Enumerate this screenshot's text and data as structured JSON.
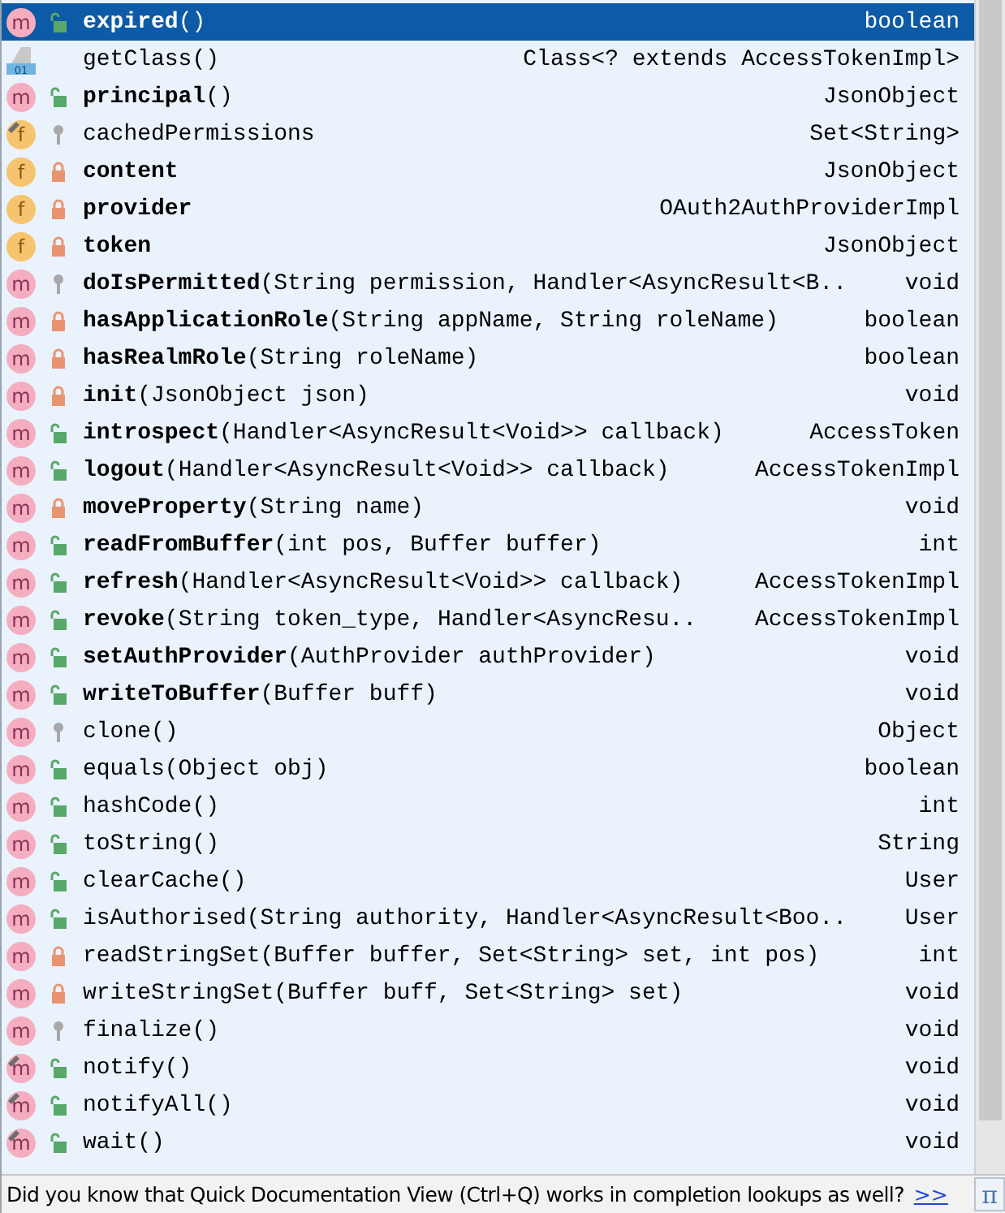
{
  "items": [
    {
      "kind": "method",
      "badge": "m",
      "access": {
        "kind": "public"
      },
      "inherited": false,
      "selected": true,
      "label": "**expired**()",
      "type": "boolean"
    },
    {
      "kind": "class",
      "badge": "01",
      "access": {
        "kind": "none"
      },
      "inherited": false,
      "selected": false,
      "label": "getClass()",
      "type": "Class<? extends AccessTokenImpl>"
    },
    {
      "kind": "method",
      "badge": "m",
      "access": {
        "kind": "public"
      },
      "inherited": false,
      "selected": false,
      "label": "**principal**()",
      "type": "JsonObject"
    },
    {
      "kind": "field",
      "badge": "f",
      "access": {
        "kind": "protected"
      },
      "inherited": true,
      "selected": false,
      "label": "cachedPermissions",
      "type": "Set<String>"
    },
    {
      "kind": "field",
      "badge": "f",
      "access": {
        "kind": "private"
      },
      "inherited": false,
      "selected": false,
      "label": "**content**",
      "type": "JsonObject"
    },
    {
      "kind": "field",
      "badge": "f",
      "access": {
        "kind": "private"
      },
      "inherited": false,
      "selected": false,
      "label": "**provider**",
      "type": "OAuth2AuthProviderImpl"
    },
    {
      "kind": "field",
      "badge": "f",
      "access": {
        "kind": "private"
      },
      "inherited": false,
      "selected": false,
      "label": "**token**",
      "type": "JsonObject"
    },
    {
      "kind": "method",
      "badge": "m",
      "access": {
        "kind": "protected"
      },
      "inherited": false,
      "selected": false,
      "label": "**doIsPermitted**(String permission, Handler<AsyncResult<B..",
      "type": "void"
    },
    {
      "kind": "method",
      "badge": "m",
      "access": {
        "kind": "private"
      },
      "inherited": false,
      "selected": false,
      "label": "**hasApplicationRole**(String appName, String roleName)",
      "type": "boolean"
    },
    {
      "kind": "method",
      "badge": "m",
      "access": {
        "kind": "private"
      },
      "inherited": false,
      "selected": false,
      "label": "**hasRealmRole**(String roleName)",
      "type": "boolean"
    },
    {
      "kind": "method",
      "badge": "m",
      "access": {
        "kind": "private"
      },
      "inherited": false,
      "selected": false,
      "label": "**init**(JsonObject json)",
      "type": "void"
    },
    {
      "kind": "method",
      "badge": "m",
      "access": {
        "kind": "public"
      },
      "inherited": false,
      "selected": false,
      "label": "**introspect**(Handler<AsyncResult<Void>> callback)",
      "type": "AccessToken"
    },
    {
      "kind": "method",
      "badge": "m",
      "access": {
        "kind": "public"
      },
      "inherited": false,
      "selected": false,
      "label": "**logout**(Handler<AsyncResult<Void>> callback)",
      "type": "AccessTokenImpl"
    },
    {
      "kind": "method",
      "badge": "m",
      "access": {
        "kind": "private"
      },
      "inherited": false,
      "selected": false,
      "label": "**moveProperty**(String name)",
      "type": "void"
    },
    {
      "kind": "method",
      "badge": "m",
      "access": {
        "kind": "public"
      },
      "inherited": false,
      "selected": false,
      "label": "**readFromBuffer**(int pos, Buffer buffer)",
      "type": "int"
    },
    {
      "kind": "method",
      "badge": "m",
      "access": {
        "kind": "public"
      },
      "inherited": false,
      "selected": false,
      "label": "**refresh**(Handler<AsyncResult<Void>> callback)",
      "type": "AccessTokenImpl"
    },
    {
      "kind": "method",
      "badge": "m",
      "access": {
        "kind": "public"
      },
      "inherited": false,
      "selected": false,
      "label": "**revoke**(String token_type, Handler<AsyncResu..",
      "type": "AccessTokenImpl"
    },
    {
      "kind": "method",
      "badge": "m",
      "access": {
        "kind": "public"
      },
      "inherited": false,
      "selected": false,
      "label": "**setAuthProvider**(AuthProvider authProvider)",
      "type": "void"
    },
    {
      "kind": "method",
      "badge": "m",
      "access": {
        "kind": "public"
      },
      "inherited": false,
      "selected": false,
      "label": "**writeToBuffer**(Buffer buff)",
      "type": "void"
    },
    {
      "kind": "method",
      "badge": "m",
      "access": {
        "kind": "protected"
      },
      "inherited": false,
      "selected": false,
      "label": "clone()",
      "type": "Object"
    },
    {
      "kind": "method",
      "badge": "m",
      "access": {
        "kind": "public"
      },
      "inherited": false,
      "selected": false,
      "label": "equals(Object obj)",
      "type": "boolean"
    },
    {
      "kind": "method",
      "badge": "m",
      "access": {
        "kind": "public"
      },
      "inherited": false,
      "selected": false,
      "label": "hashCode()",
      "type": "int"
    },
    {
      "kind": "method",
      "badge": "m",
      "access": {
        "kind": "public"
      },
      "inherited": false,
      "selected": false,
      "label": "toString()",
      "type": "String"
    },
    {
      "kind": "method",
      "badge": "m",
      "access": {
        "kind": "public"
      },
      "inherited": false,
      "selected": false,
      "label": "clearCache()",
      "type": "User"
    },
    {
      "kind": "method",
      "badge": "m",
      "access": {
        "kind": "public"
      },
      "inherited": false,
      "selected": false,
      "label": "isAuthorised(String authority, Handler<AsyncResult<Boo..",
      "type": "User"
    },
    {
      "kind": "method",
      "badge": "m",
      "access": {
        "kind": "private"
      },
      "inherited": false,
      "selected": false,
      "label": "readStringSet(Buffer buffer, Set<String> set, int pos)",
      "type": "int"
    },
    {
      "kind": "method",
      "badge": "m",
      "access": {
        "kind": "private"
      },
      "inherited": false,
      "selected": false,
      "label": "writeStringSet(Buffer buff, Set<String> set)",
      "type": "void"
    },
    {
      "kind": "method",
      "badge": "m",
      "access": {
        "kind": "protected"
      },
      "inherited": false,
      "selected": false,
      "label": "finalize()",
      "type": "void"
    },
    {
      "kind": "method",
      "badge": "m",
      "access": {
        "kind": "public"
      },
      "inherited": true,
      "selected": false,
      "label": "notify()",
      "type": "void"
    },
    {
      "kind": "method",
      "badge": "m",
      "access": {
        "kind": "public"
      },
      "inherited": true,
      "selected": false,
      "label": "notifyAll()",
      "type": "void"
    },
    {
      "kind": "method",
      "badge": "m",
      "access": {
        "kind": "public"
      },
      "inherited": true,
      "selected": false,
      "label": "wait()",
      "type": "void"
    }
  ],
  "hint": {
    "text": "Did you know that Quick Documentation View (Ctrl+Q) works in completion lookups as well?",
    "link": ">>",
    "button": "π"
  }
}
